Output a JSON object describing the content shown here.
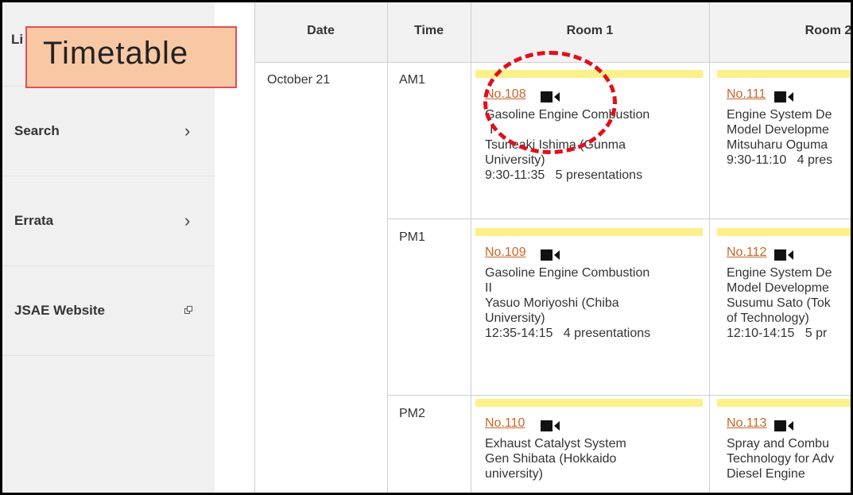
{
  "sidebar": {
    "top_stub": "Li",
    "items": [
      {
        "label": "Search",
        "icon": "chevron-right-icon",
        "glyph": "›"
      },
      {
        "label": "Errata",
        "icon": "chevron-right-icon",
        "glyph": "›"
      },
      {
        "label": "JSAE Website",
        "icon": "external-link-icon"
      }
    ]
  },
  "annotation": {
    "label": "Timetable",
    "box_color": "#f8c8a4",
    "circle_color": "#e0101c"
  },
  "table": {
    "headers": [
      "Date",
      "Time",
      "Room 1",
      "Room 2"
    ],
    "date": "October 21",
    "slots": [
      "AM1",
      "PM1",
      "PM2"
    ],
    "room1": [
      {
        "no": "No.108",
        "lines": [
          "Gasoline Engine Combustion",
          "I",
          "Tsuneaki Ishima (Gunma",
          "University)",
          "9:30-11:35   5 presentations"
        ]
      },
      {
        "no": "No.109",
        "lines": [
          "Gasoline Engine Combustion",
          "II",
          "Yasuo Moriyoshi (Chiba",
          "University)",
          "12:35-14:15   4 presentations"
        ]
      },
      {
        "no": "No.110",
        "lines": [
          "Exhaust Catalyst System",
          "Gen Shibata (Hokkaido",
          "university)"
        ]
      }
    ],
    "room2": [
      {
        "no": "No.111",
        "lines": [
          "Engine System De",
          "Model Developme",
          "Mitsuharu Oguma",
          "9:30-11:10   4 pres"
        ]
      },
      {
        "no": "No.112",
        "lines": [
          "Engine System De",
          "Model Developme",
          "Susumu Sato (Tok",
          "of Technology)",
          "12:10-14:15   5 pr"
        ]
      },
      {
        "no": "No.113",
        "lines": [
          "Spray and Combu",
          "Technology for Adv",
          "Diesel Engine"
        ]
      }
    ],
    "colors": {
      "link": "#c8662a",
      "session_bar": "#fbf08a",
      "header_bg": "#f2f2f2"
    }
  }
}
